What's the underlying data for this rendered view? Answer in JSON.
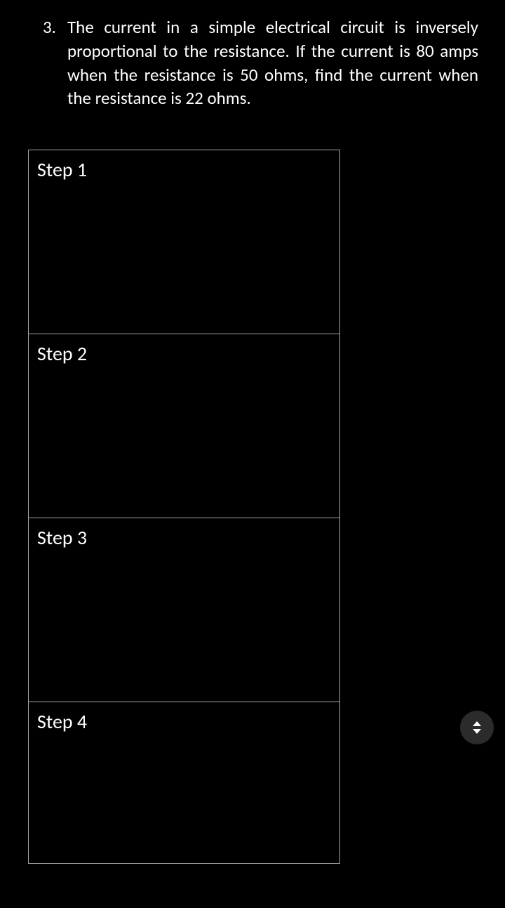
{
  "question": {
    "number": "3.",
    "text": "The current in a simple electrical circuit is inversely proportional to the resistance. If the current is 80 amps when the resistance is 50 ohms, find the current when the resistance is 22 ohms."
  },
  "steps": [
    {
      "label": "Step 1"
    },
    {
      "label": "Step 2"
    },
    {
      "label": "Step 3"
    },
    {
      "label": "Step 4"
    }
  ]
}
